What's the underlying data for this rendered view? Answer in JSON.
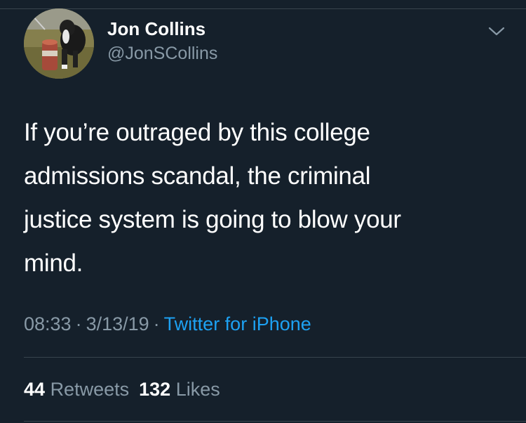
{
  "tweet": {
    "author": {
      "display_name": "Jon Collins",
      "handle": "@JonSCollins"
    },
    "text_lines": [
      "If you’re outraged by this college",
      "admissions scandal, the criminal",
      "justice system is going to blow your",
      "mind."
    ],
    "meta": {
      "time": "08:33",
      "date": "3/13/19",
      "separator": "·",
      "source": "Twitter for iPhone"
    },
    "stats": {
      "retweets_count": "44",
      "retweets_label": "Retweets",
      "likes_count": "132",
      "likes_label": "Likes"
    }
  },
  "icons": {
    "more_menu": "chevron-down-icon"
  },
  "colors": {
    "background": "#15202b",
    "text": "#ffffff",
    "secondary_text": "#8899a6",
    "link": "#1da1f2",
    "divider": "#38444d"
  }
}
